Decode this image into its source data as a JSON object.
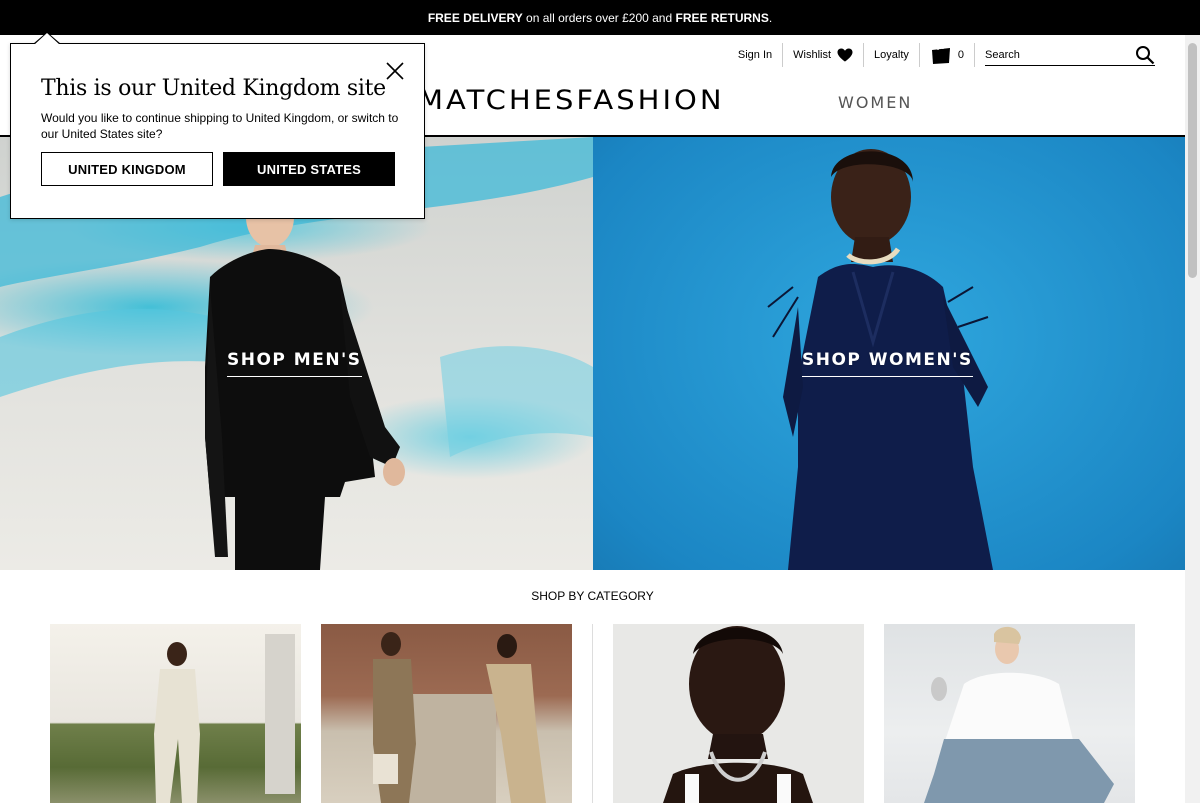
{
  "promo": {
    "part1": "FREE DELIVERY",
    "part2": " on all orders over £200 and ",
    "part3": "FREE RETURNS",
    "part4": "."
  },
  "header": {
    "sign_in": "Sign In",
    "wishlist": "Wishlist",
    "loyalty": "Loyalty",
    "bag_count": "0",
    "search_placeholder": "Search",
    "logo": "MATCHESFASHION",
    "gender": "WOMEN"
  },
  "hero": {
    "men_label": "SHOP MEN'S",
    "women_label": "SHOP WOMEN'S"
  },
  "category": {
    "title": "SHOP BY CATEGORY"
  },
  "popup": {
    "title": "This is our United Kingdom site",
    "body": "Would you like to continue shipping to United Kingdom, or switch to our United States site?",
    "uk_button": "UNITED KINGDOM",
    "us_button": "UNITED STATES"
  },
  "colors": {
    "accent": "#000000",
    "women_bg": "#1b86c4",
    "scarf": "#4cc3dc"
  },
  "icons": [
    "heart-icon",
    "bag-icon",
    "search-icon",
    "close-icon"
  ]
}
